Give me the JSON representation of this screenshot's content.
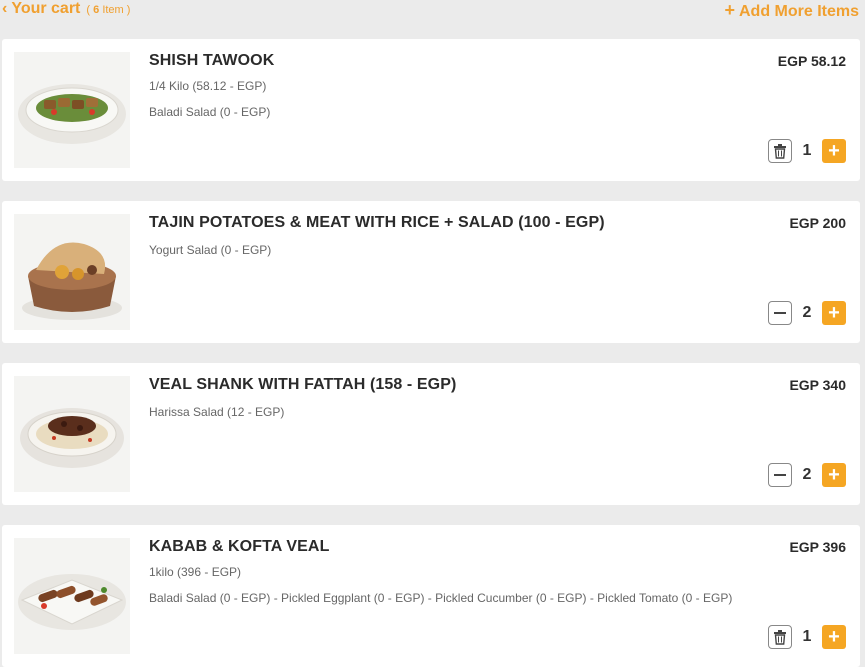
{
  "header": {
    "back_icon": "chevron-left-icon",
    "title": "Your cart",
    "count_number": "6",
    "count_suffix": "Item",
    "add_more_label": "Add More Items"
  },
  "colors": {
    "accent": "#f5a623",
    "background": "#ebebeb",
    "card": "#ffffff",
    "text": "#2b2b2b"
  },
  "items": [
    {
      "name": "SHISH TAWOOK",
      "options": [
        "1/4 Kilo (58.12 - EGP)",
        "Baladi Salad (0 - EGP)"
      ],
      "price": "EGP 58.12",
      "quantity": "1",
      "left_control": "trash-icon"
    },
    {
      "name": "TAJIN POTATOES & MEAT WITH RICE + SALAD (100 - EGP)",
      "options": [
        "Yogurt Salad (0 - EGP)"
      ],
      "price": "EGP 200",
      "quantity": "2",
      "left_control": "minus-icon"
    },
    {
      "name": "VEAL SHANK WITH FATTAH (158 - EGP)",
      "options": [
        "Harissa Salad (12 - EGP)"
      ],
      "price": "EGP 340",
      "quantity": "2",
      "left_control": "minus-icon"
    },
    {
      "name": "KABAB & KOFTA VEAL",
      "options": [
        "1kilo (396 - EGP)",
        "Baladi Salad (0 - EGP) - Pickled Eggplant (0 - EGP) - Pickled Cucumber (0 - EGP) - Pickled Tomato (0 - EGP)"
      ],
      "price": "EGP 396",
      "quantity": "1",
      "left_control": "trash-icon"
    }
  ]
}
